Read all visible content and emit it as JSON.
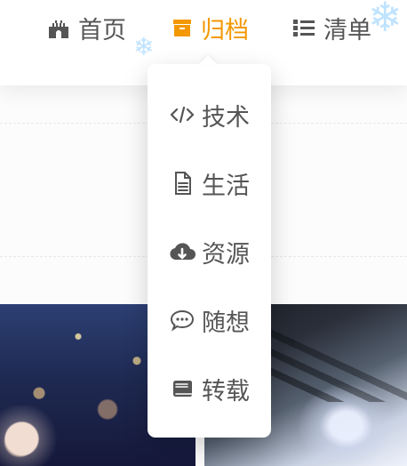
{
  "colors": {
    "accent": "#f39800",
    "text": "#555555",
    "snow": "#bfe3ff"
  },
  "nav": {
    "items": [
      {
        "label": "首页",
        "icon": "castle-icon",
        "active": false
      },
      {
        "label": "归档",
        "icon": "archive-box-icon",
        "active": true
      },
      {
        "label": "清单",
        "icon": "list-icon",
        "active": false
      }
    ]
  },
  "dropdown": {
    "items": [
      {
        "label": "技术",
        "icon": "code-icon"
      },
      {
        "label": "生活",
        "icon": "document-icon"
      },
      {
        "label": "资源",
        "icon": "cloud-download-icon"
      },
      {
        "label": "随想",
        "icon": "chat-bubble-icon"
      },
      {
        "label": "转载",
        "icon": "book-icon"
      }
    ]
  },
  "decorations": {
    "snowflake_icon": "snowflake-icon"
  }
}
